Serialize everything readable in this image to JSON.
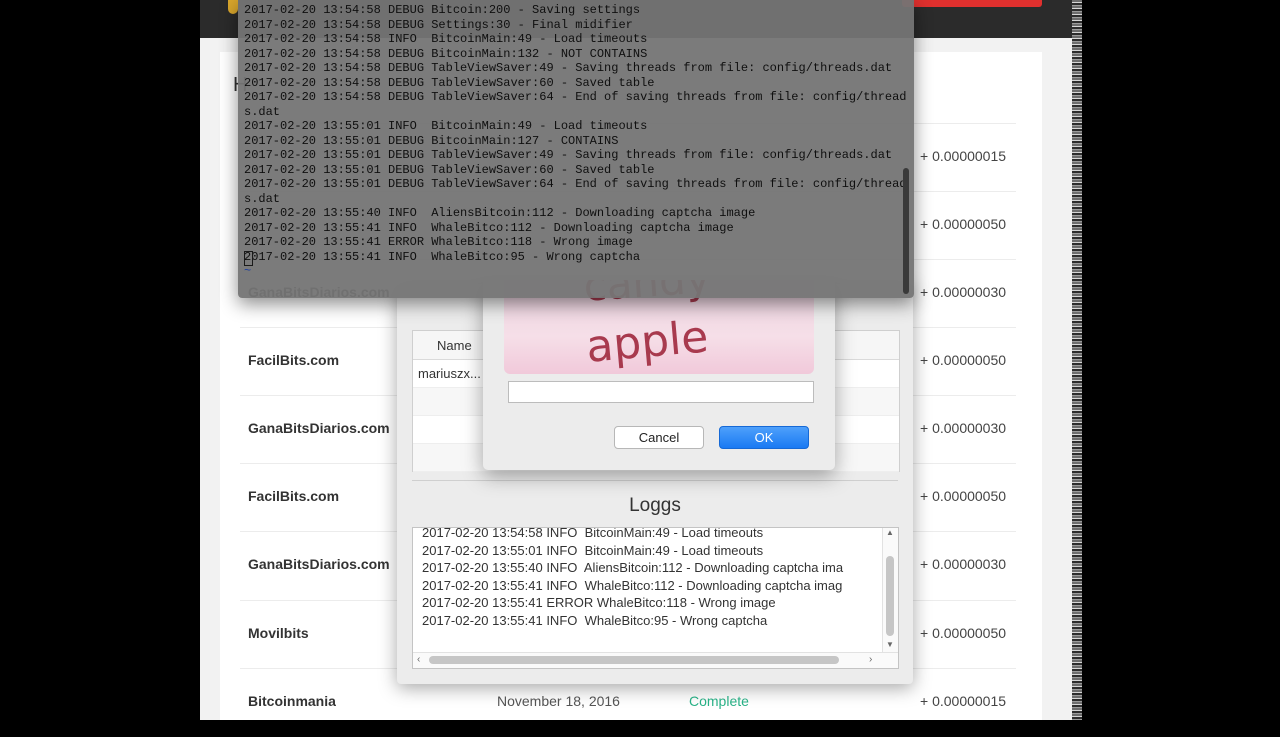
{
  "webpage": {
    "heading_stub": "H",
    "rows": [
      {
        "site": "",
        "date": "",
        "status": "",
        "amount": "+ 0.00000015"
      },
      {
        "site": "",
        "date": "",
        "status": "",
        "amount": "+ 0.00000050"
      },
      {
        "site": "GanaBitsDiarios.com",
        "date": "",
        "status": "",
        "amount": "+ 0.00000030"
      },
      {
        "site": "FacilBits.com",
        "date": "",
        "status": "",
        "amount": "+ 0.00000050"
      },
      {
        "site": "GanaBitsDiarios.com",
        "date": "",
        "status": "",
        "amount": "+ 0.00000030"
      },
      {
        "site": "FacilBits.com",
        "date": "",
        "status": "",
        "amount": "+ 0.00000050"
      },
      {
        "site": "GanaBitsDiarios.com",
        "date": "",
        "status": "",
        "amount": "+ 0.00000030"
      },
      {
        "site": "Movilbits",
        "date": "",
        "status": "",
        "amount": "+ 0.00000050"
      },
      {
        "site": "Bitcoinmania",
        "date": "November 18, 2016",
        "status": "Complete",
        "amount": "+ 0.00000015"
      }
    ],
    "colors": {
      "status_complete": "#29b388",
      "header_bg": "#2b2b2b",
      "header_button": "#e0302e"
    }
  },
  "terminal": {
    "lines": [
      "2017-02-20 13:54:58 DEBUG Bitcoin:200 - Saving settings",
      "2017-02-20 13:54:58 DEBUG Settings:30 - Final midifier",
      "2017-02-20 13:54:58 INFO  BitcoinMain:49 - Load timeouts",
      "2017-02-20 13:54:58 DEBUG BitcoinMain:132 - NOT CONTAINS",
      "2017-02-20 13:54:58 DEBUG TableViewSaver:49 - Saving threads from file: config/threads.dat",
      "2017-02-20 13:54:58 DEBUG TableViewSaver:60 - Saved table",
      "2017-02-20 13:54:58 DEBUG TableViewSaver:64 - End of saving threads from file: config/thread",
      "s.dat",
      "2017-02-20 13:55:01 INFO  BitcoinMain:49 - Load timeouts",
      "2017-02-20 13:55:01 DEBUG BitcoinMain:127 - CONTAINS",
      "2017-02-20 13:55:01 DEBUG TableViewSaver:49 - Saving threads from file: config/threads.dat",
      "2017-02-20 13:55:01 DEBUG TableViewSaver:60 - Saved table",
      "2017-02-20 13:55:01 DEBUG TableViewSaver:64 - End of saving threads from file: config/thread",
      "s.dat",
      "2017-02-20 13:55:40 INFO  AliensBitcoin:112 - Downloading captcha image",
      "2017-02-20 13:55:41 INFO  WhaleBitco:112 - Downloading captcha image",
      "2017-02-20 13:55:41 ERROR WhaleBitco:118 - Wrong image",
      "2017-02-20 13:55:41 INFO  WhaleBitco:95 - Wrong captcha"
    ],
    "tilde": "~"
  },
  "app": {
    "table": {
      "column_name": "Name",
      "rows": [
        "mariuszx...",
        "",
        "",
        ""
      ]
    },
    "loggs": {
      "title": "Loggs",
      "lines": [
        "2017-02-20 13:54:58 INFO  BitcoinMain:49 - Load timeouts",
        "2017-02-20 13:55:01 INFO  BitcoinMain:49 - Load timeouts",
        "2017-02-20 13:55:40 INFO  AliensBitcoin:112 - Downloading captcha ima",
        "2017-02-20 13:55:41 INFO  WhaleBitco:112 - Downloading captcha imag",
        "2017-02-20 13:55:41 ERROR WhaleBitco:118 - Wrong image",
        "2017-02-20 13:55:41 INFO  WhaleBitco:95 - Wrong captcha"
      ]
    }
  },
  "dialog": {
    "captcha_text": "apple",
    "captcha_partial_text": "candy",
    "input_value": "",
    "cancel_label": "Cancel",
    "ok_label": "OK",
    "colors": {
      "ok_button": "#1a7af3",
      "captcha_ink": "#a83a4e"
    }
  }
}
